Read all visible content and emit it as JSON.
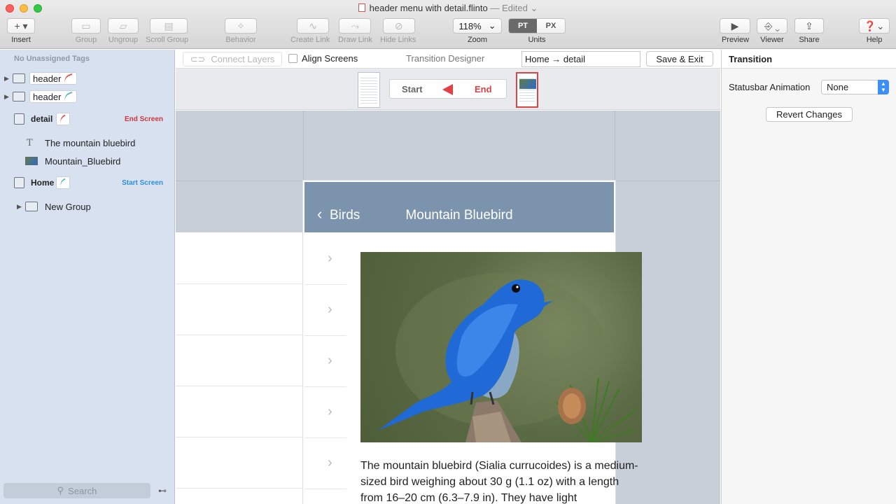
{
  "window": {
    "doc_title": "header menu with detail.flinto",
    "edited": "— Edited",
    "colors": {
      "end": "#d0353b",
      "start": "#2f8fd8",
      "header": "#7c93ad",
      "accent": "#3d8ff6"
    }
  },
  "toolbar": {
    "insert": {
      "glyph": "+ ▾",
      "label": "Insert"
    },
    "group": {
      "label": "Group"
    },
    "ungroup": {
      "label": "Ungroup"
    },
    "scroll_group": {
      "label": "Scroll Group"
    },
    "behavior": {
      "label": "Behavior"
    },
    "create_link": {
      "label": "Create Link"
    },
    "draw_link": {
      "label": "Draw Link"
    },
    "hide_links": {
      "label": "Hide Links"
    },
    "zoom": {
      "value": "118%",
      "label": "Zoom"
    },
    "units": {
      "pt": "PT",
      "px": "PX",
      "label": "Units",
      "active": "PT"
    },
    "preview": {
      "label": "Preview"
    },
    "viewer": {
      "label": "Viewer"
    },
    "share": {
      "label": "Share"
    },
    "help": {
      "label": "Help"
    }
  },
  "sidebar": {
    "header": "No Unassigned Tags",
    "layers": [
      {
        "label": "header",
        "icon": "folder-icon"
      },
      {
        "label": "header",
        "icon": "folder-icon"
      },
      {
        "label": "detail",
        "icon": "screen-icon",
        "tag": "End Screen"
      },
      {
        "label": "The mountain bluebird",
        "icon": "text-icon"
      },
      {
        "label": "Mountain_Bluebird",
        "icon": "image-icon"
      },
      {
        "label": "Home",
        "icon": "home-screen-icon",
        "tag": "Start Screen"
      },
      {
        "label": "New Group",
        "icon": "group-icon"
      }
    ],
    "search_placeholder": "Search"
  },
  "designer": {
    "connect_layers": "Connect Layers",
    "align_screens": "Align Screens",
    "title": "Transition Designer",
    "transition_name": "Home → detail",
    "save_exit": "Save & Exit",
    "start": "Start",
    "end": "End"
  },
  "phone": {
    "back_label": "Birds",
    "title": "Mountain Bluebird",
    "body": "The mountain bluebird (Sialia currucoides) is a medium-sized bird weighing about 30 g (1.1 oz) with a length from 16–20 cm (6.3–7.9 in). They have light"
  },
  "inspector": {
    "title": "Transition",
    "statusbar_label": "Statusbar Animation",
    "statusbar_value": "None",
    "revert": "Revert Changes"
  }
}
